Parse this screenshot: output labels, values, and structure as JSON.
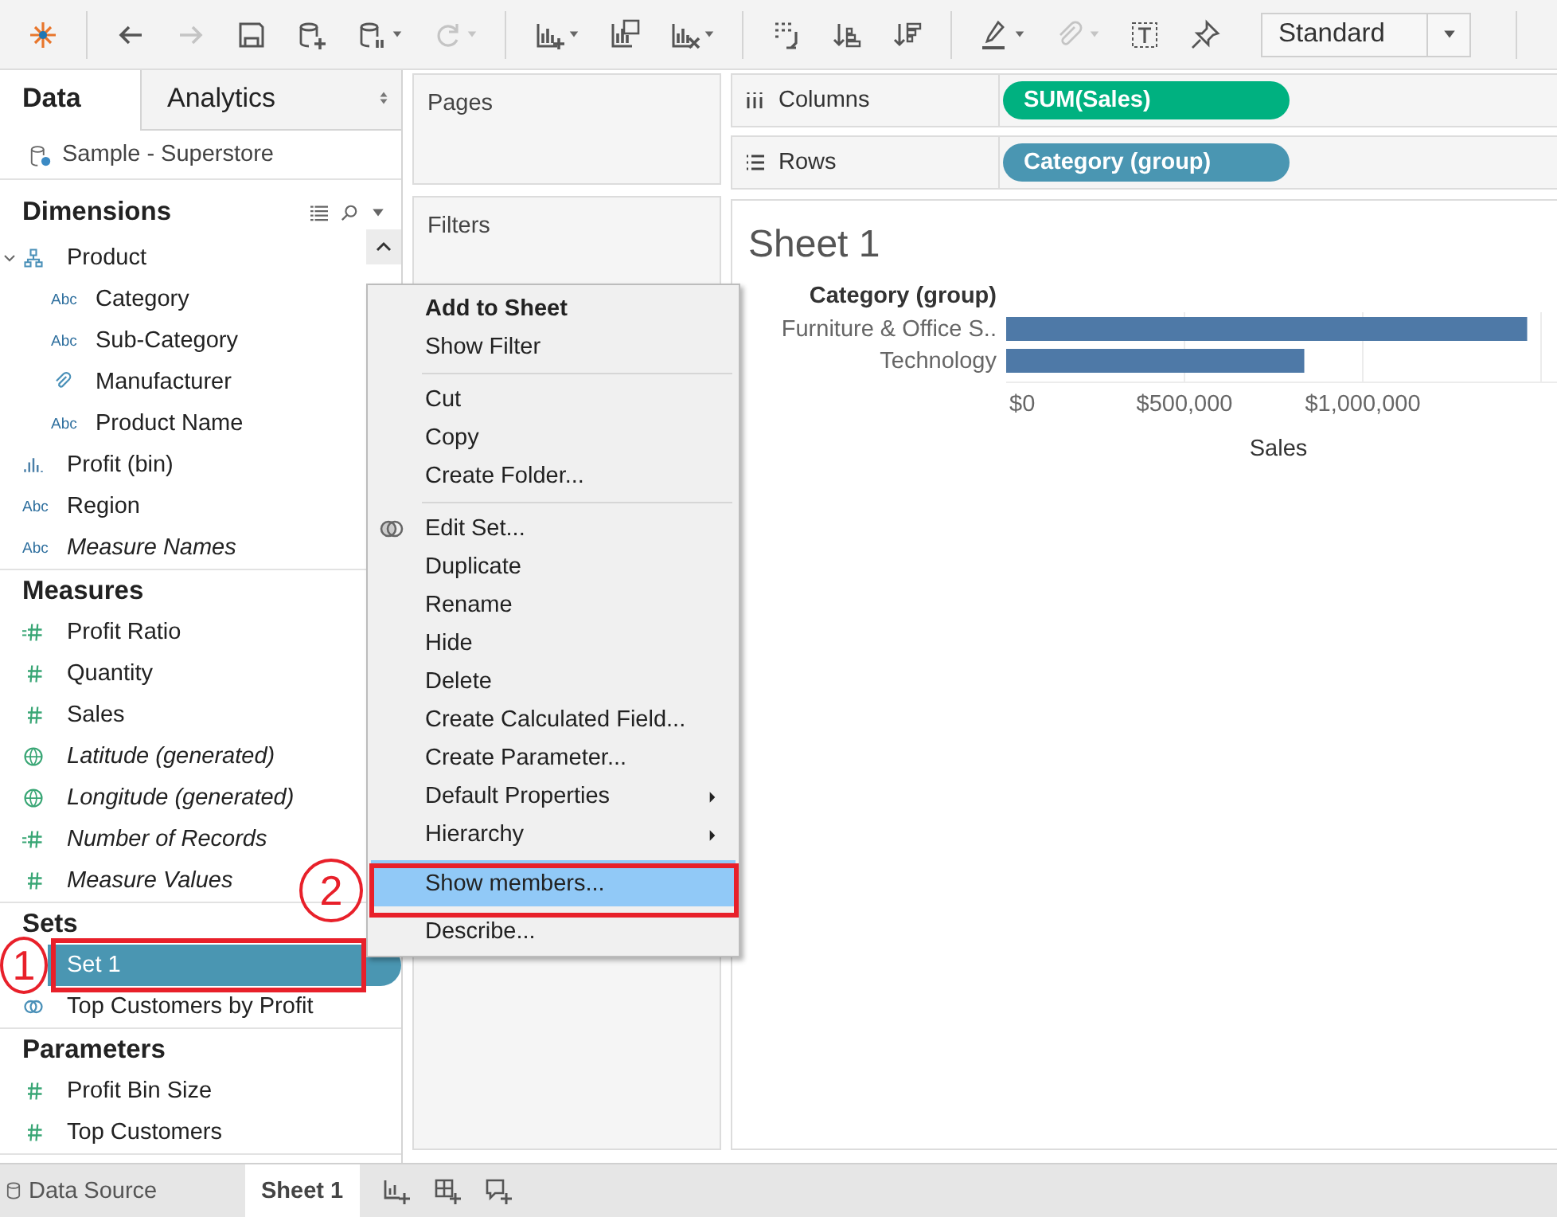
{
  "toolbar": {
    "groups": [
      [
        {
          "kind": "back",
          "disabled": false,
          "menu": false
        },
        {
          "kind": "forward",
          "disabled": true,
          "menu": false
        },
        {
          "kind": "save",
          "disabled": false,
          "menu": false
        },
        {
          "kind": "new-datasource",
          "disabled": false,
          "menu": false
        },
        {
          "kind": "pause",
          "disabled": false,
          "menu": true
        },
        {
          "kind": "refresh",
          "disabled": true,
          "menu": true
        }
      ],
      [
        {
          "kind": "new-sheet",
          "disabled": false,
          "menu": true
        },
        {
          "kind": "duplicate",
          "disabled": false,
          "menu": false
        },
        {
          "kind": "clear",
          "disabled": false,
          "menu": true
        }
      ],
      [
        {
          "kind": "swap",
          "disabled": false,
          "menu": false
        },
        {
          "kind": "sort-asc",
          "disabled": false,
          "menu": false
        },
        {
          "kind": "sort-desc",
          "disabled": false,
          "menu": false
        }
      ],
      [
        {
          "kind": "highlight",
          "disabled": false,
          "menu": true
        },
        {
          "kind": "group",
          "disabled": true,
          "menu": true
        },
        {
          "kind": "labels",
          "disabled": false,
          "menu": false
        },
        {
          "kind": "pin",
          "disabled": false,
          "menu": false
        }
      ]
    ],
    "fit": "Standard"
  },
  "side_tabs": [
    {
      "label": "Data",
      "selected": true
    },
    {
      "label": "Analytics",
      "selected": false
    }
  ],
  "data_source": "Sample - Superstore",
  "sections": [
    {
      "title": "Dimensions",
      "fields": [
        {
          "label": "Product",
          "kind": "hierarchy",
          "generated": false,
          "selected": false,
          "expanded": true,
          "children": [
            {
              "label": "Category",
              "kind": "string",
              "glyph": "Abc",
              "generated": false,
              "selected": false
            },
            {
              "label": "Sub-Category",
              "kind": "string",
              "glyph": "Abc",
              "generated": false,
              "selected": false
            },
            {
              "label": "Manufacturer",
              "kind": "group",
              "generated": false,
              "selected": false
            },
            {
              "label": "Product Name",
              "kind": "string",
              "glyph": "Abc",
              "generated": false,
              "selected": false
            }
          ]
        },
        {
          "label": "Profit (bin)",
          "kind": "bin",
          "generated": false,
          "selected": false
        },
        {
          "label": "Region",
          "kind": "string",
          "glyph": "Abc",
          "generated": false,
          "selected": false
        },
        {
          "label": "Measure Names",
          "kind": "string",
          "glyph": "Abc",
          "generated": true,
          "selected": false
        }
      ]
    },
    {
      "title": "Measures",
      "fields": [
        {
          "label": "Profit Ratio",
          "kind": "calc",
          "generated": false,
          "selected": false
        },
        {
          "label": "Quantity",
          "kind": "number",
          "generated": false,
          "selected": false
        },
        {
          "label": "Sales",
          "kind": "number",
          "generated": false,
          "selected": false
        },
        {
          "label": "Latitude (generated)",
          "kind": "geo",
          "generated": true,
          "selected": false
        },
        {
          "label": "Longitude (generated)",
          "kind": "geo",
          "generated": true,
          "selected": false
        },
        {
          "label": "Number of Records",
          "kind": "calc",
          "generated": true,
          "selected": false
        },
        {
          "label": "Measure Values",
          "kind": "number",
          "generated": true,
          "selected": false
        }
      ]
    },
    {
      "title": "Sets",
      "fields": [
        {
          "label": "Set 1",
          "kind": "set",
          "generated": false,
          "selected": true
        },
        {
          "label": "Top Customers by Profit",
          "kind": "set",
          "generated": false,
          "selected": false
        }
      ]
    },
    {
      "title": "Parameters",
      "fields": [
        {
          "label": "Profit Bin Size",
          "kind": "number",
          "generated": false,
          "selected": false
        },
        {
          "label": "Top Customers",
          "kind": "number",
          "generated": false,
          "selected": false
        }
      ]
    }
  ],
  "cards": {
    "pages": "Pages",
    "filters": "Filters"
  },
  "shelves": [
    {
      "label": "Columns",
      "kind": "columns",
      "pill": "SUM(Sales)",
      "color": "#00b180"
    },
    {
      "label": "Rows",
      "kind": "rows",
      "pill": "Category (group)",
      "color": "#4a96b2"
    }
  ],
  "sheet": {
    "title": "Sheet 1",
    "chart_data": {
      "type": "bar",
      "orientation": "horizontal",
      "ylabel": "Category (group)",
      "xlabel": "Sales",
      "categories": [
        "Furniture & Office S..",
        "Technology"
      ],
      "values": [
        1461000,
        836000
      ],
      "xlim": [
        0,
        1500000
      ],
      "xticks": [
        {
          "value": 0,
          "label": "$0"
        },
        {
          "value": 500000,
          "label": "$500,000"
        },
        {
          "value": 1000000,
          "label": "$1,000,000"
        }
      ]
    }
  },
  "context_menu": {
    "groups": [
      [
        {
          "label": "Add to Sheet",
          "default": true,
          "submenu": false,
          "selected": false
        },
        {
          "label": "Show Filter",
          "default": false,
          "submenu": false,
          "selected": false
        }
      ],
      [
        {
          "label": "Cut",
          "default": false,
          "submenu": false,
          "selected": false
        },
        {
          "label": "Copy",
          "default": false,
          "submenu": false,
          "selected": false
        },
        {
          "label": "Create Folder...",
          "default": false,
          "submenu": false,
          "selected": false
        }
      ],
      [
        {
          "label": "Edit Set...",
          "kind": "set",
          "default": false,
          "submenu": false,
          "selected": false
        },
        {
          "label": "Duplicate",
          "default": false,
          "submenu": false,
          "selected": false
        },
        {
          "label": "Rename",
          "default": false,
          "submenu": false,
          "selected": false
        },
        {
          "label": "Hide",
          "default": false,
          "submenu": false,
          "selected": false
        },
        {
          "label": "Delete",
          "default": false,
          "submenu": false,
          "selected": false
        },
        {
          "label": "Create Calculated Field...",
          "default": false,
          "submenu": false,
          "selected": false
        },
        {
          "label": "Create Parameter...",
          "default": false,
          "submenu": false,
          "selected": false
        },
        {
          "label": "Default Properties",
          "default": false,
          "submenu": true,
          "selected": false
        },
        {
          "label": "Hierarchy",
          "default": false,
          "submenu": true,
          "selected": false
        },
        {
          "label": "Show members...",
          "default": false,
          "submenu": false,
          "selected": true
        },
        {
          "label": "Describe...",
          "default": false,
          "submenu": false,
          "selected": false
        }
      ]
    ]
  },
  "callouts": [
    {
      "number": "1"
    },
    {
      "number": "2"
    }
  ],
  "bottom_tabs": [
    {
      "label": "Data Source",
      "kind": "data-source",
      "selected": false
    },
    {
      "label": "Sheet 1",
      "kind": "sheet",
      "selected": true
    }
  ],
  "bottom_actions": [
    {
      "kind": "new-sheet"
    },
    {
      "kind": "new-dashboard"
    },
    {
      "kind": "new-story"
    }
  ]
}
